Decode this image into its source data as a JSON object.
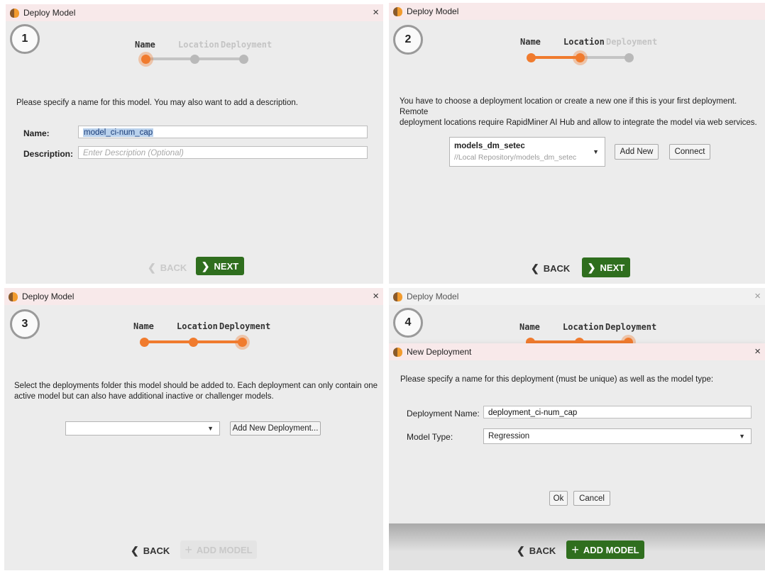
{
  "window_title": "Deploy Model",
  "close_glyph": "×",
  "step_labels": {
    "name": "Name",
    "location": "Location",
    "deployment": "Deployment"
  },
  "nav": {
    "back": "BACK",
    "next": "NEXT",
    "add_model": "ADD MODEL"
  },
  "colors": {
    "accent_orange": "#f07b2e",
    "next_green": "#2f6e1e",
    "inactive_gray": "#b9b9b9"
  },
  "icons": {
    "back": "chevron-left-icon",
    "next": "chevron-right-icon",
    "add": "plus-icon",
    "app": "app-logo-icon",
    "close": "close-icon",
    "dropdown": "dropdown-arrow-icon"
  },
  "panel1": {
    "step_number": "1",
    "description": "Please specify a name for this model. You may also want to add a description.",
    "name_label": "Name:",
    "name_value": "model_ci-num_cap",
    "description_label": "Description:",
    "description_placeholder": "Enter Description (Optional)"
  },
  "panel2": {
    "step_number": "2",
    "description_line1": "You have to choose a deployment location or create a new one if this is your first deployment. Remote",
    "description_line2": "deployment locations require RapidMiner AI Hub and allow to integrate the model via web services.",
    "location_name": "models_dm_setec",
    "location_path": "//Local Repository/models_dm_setec",
    "add_new": "Add New",
    "connect": "Connect"
  },
  "panel3": {
    "step_number": "3",
    "description_line1": "Select the deployments folder this model should be added to. Each deployment can only contain one",
    "description_line2": "active model but can also have additional inactive or challenger models.",
    "folder_value": "",
    "add_new_deployment": "Add New Deployment..."
  },
  "panel4": {
    "step_number": "4",
    "dialog_title": "New Deployment",
    "dialog_description": "Please specify a name for this deployment (must be unique) as well as the model type:",
    "deployment_name_label": "Deployment Name:",
    "deployment_name_value": "deployment_ci-num_cap",
    "model_type_label": "Model Type:",
    "model_type_value": "Regression",
    "ok": "Ok",
    "cancel": "Cancel"
  }
}
